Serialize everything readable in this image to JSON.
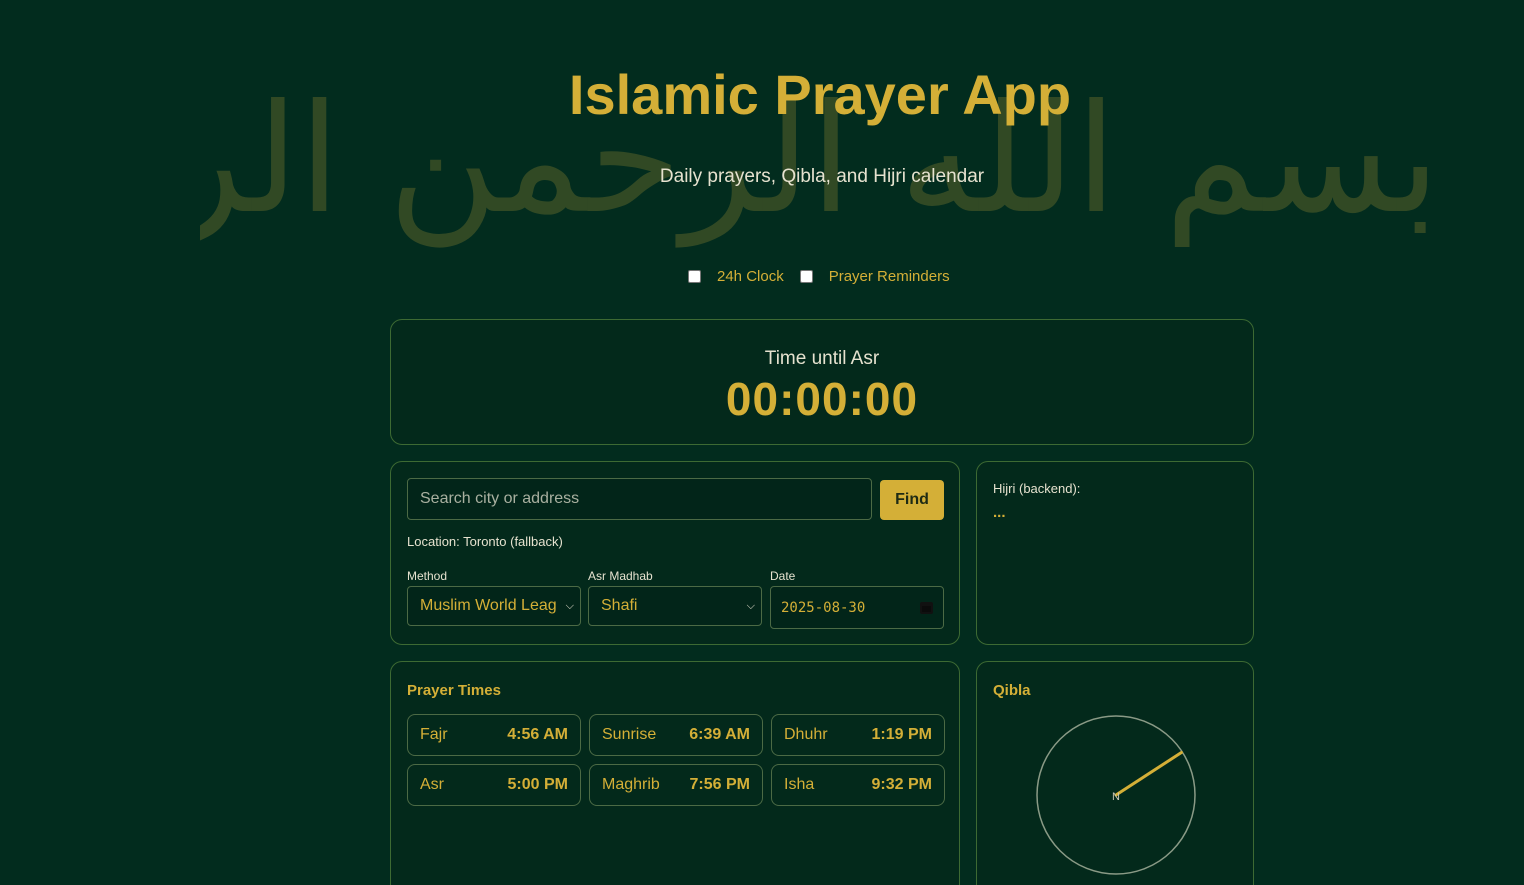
{
  "header": {
    "bismillah": "بسم الله الرحمن الرحيم",
    "title": "Islamic Prayer App",
    "subtitle": "Daily prayers, Qibla, and Hijri calendar"
  },
  "toggles": {
    "clock24": {
      "label": "24h Clock",
      "checked": false
    },
    "reminders": {
      "label": "Prayer Reminders",
      "checked": false
    }
  },
  "countdown": {
    "label": "Time until Asr",
    "time": "00:00:00"
  },
  "location": {
    "search_placeholder": "Search city or address",
    "search_value": "",
    "find_label": "Find",
    "location_text": "Location: Toronto (fallback)",
    "method_label": "Method",
    "method_value": "Muslim World Leag",
    "madhab_label": "Asr Madhab",
    "madhab_value": "Shafi",
    "date_label": "Date",
    "date_value": "2025-08-30"
  },
  "hijri": {
    "label": "Hijri (backend):",
    "value": "..."
  },
  "prayer_times": {
    "title": "Prayer Times",
    "items": [
      {
        "name": "Fajr",
        "time": "4:56 AM"
      },
      {
        "name": "Sunrise",
        "time": "6:39 AM"
      },
      {
        "name": "Dhuhr",
        "time": "1:19 PM"
      },
      {
        "name": "Asr",
        "time": "5:00 PM"
      },
      {
        "name": "Maghrib",
        "time": "7:56 PM"
      },
      {
        "name": "Isha",
        "time": "9:32 PM"
      }
    ]
  },
  "qibla": {
    "title": "Qibla",
    "north_label": "N",
    "bearing_deg": 57
  },
  "colors": {
    "background": "#022c1e",
    "accent": "#d4af37",
    "border": "#3d6a33",
    "text": "#e6e2cf"
  }
}
